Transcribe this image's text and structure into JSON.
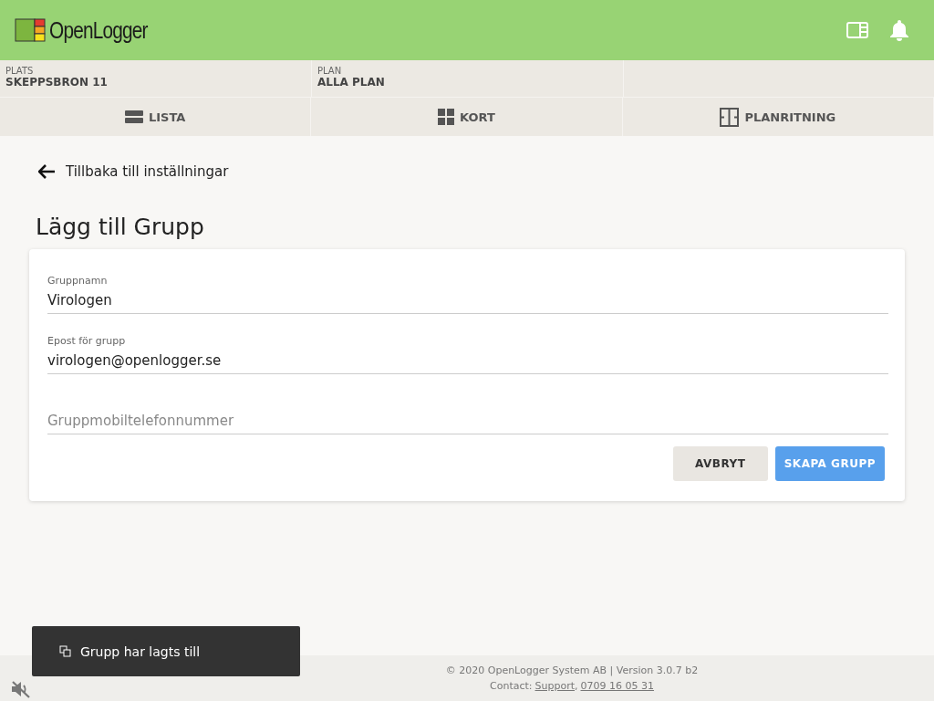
{
  "header": {
    "logo_text": "OpenLogger"
  },
  "location": [
    {
      "label": "PLATS",
      "value": "SKEPPSBRON 11"
    },
    {
      "label": "PLAN",
      "value": "ALLA PLAN"
    }
  ],
  "tabs": [
    {
      "label": "LISTA",
      "kind": "list"
    },
    {
      "label": "KORT",
      "kind": "grid"
    },
    {
      "label": "PLANRITNING",
      "kind": "floorplan"
    }
  ],
  "back_link": "Tillbaka till inställningar",
  "title": "Lägg till Grupp",
  "form": {
    "fields": [
      {
        "label": "Gruppnamn",
        "value": "Virologen"
      },
      {
        "label": "Epost för grupp",
        "value": "virologen@openlogger.se"
      },
      {
        "placeholder": "Gruppmobiltelefonnummer"
      }
    ],
    "buttons": [
      {
        "label": "AVBRYT",
        "kind": "secondary"
      },
      {
        "label": "SKAPA GRUPP",
        "kind": "primary"
      }
    ]
  },
  "toast": "Grupp har lagts till",
  "footer": {
    "copyright": "© 2020 OpenLogger System AB | Version 3.0.7 b2",
    "contact_label": "Contact:",
    "separator": ",",
    "links": [
      "Support",
      "0709 16 05 31"
    ]
  }
}
